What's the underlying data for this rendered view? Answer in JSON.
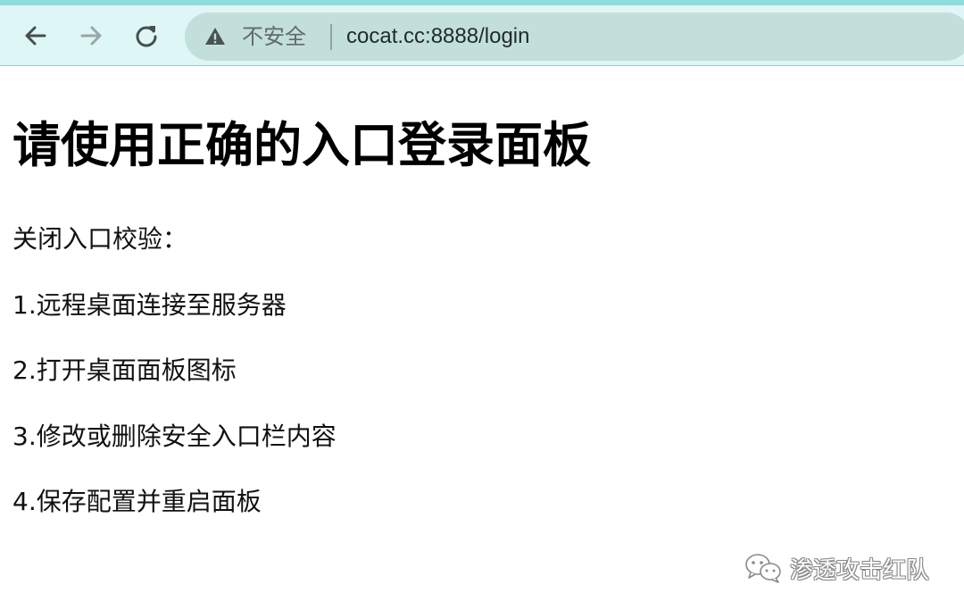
{
  "browser": {
    "security_label": "不安全",
    "url": "cocat.cc:8888/login",
    "accent_color": "#8fdcdc",
    "toolbar_color": "#dff6f6",
    "omnibox_color": "#c3dfdc"
  },
  "page": {
    "heading": "请使用正确的入口登录面板",
    "paragraphs": [
      "关闭入口校验：",
      "1.远程桌面连接至服务器",
      "2.打开桌面面板图标",
      "3.修改或删除安全入口栏内容",
      "4.保存配置并重启面板"
    ]
  },
  "watermark": {
    "text": "渗透攻击红队",
    "icon": "wechat-icon"
  },
  "icons": {
    "back": "back-arrow-icon",
    "forward": "forward-arrow-icon",
    "reload": "reload-icon",
    "warning": "warning-triangle-icon"
  }
}
